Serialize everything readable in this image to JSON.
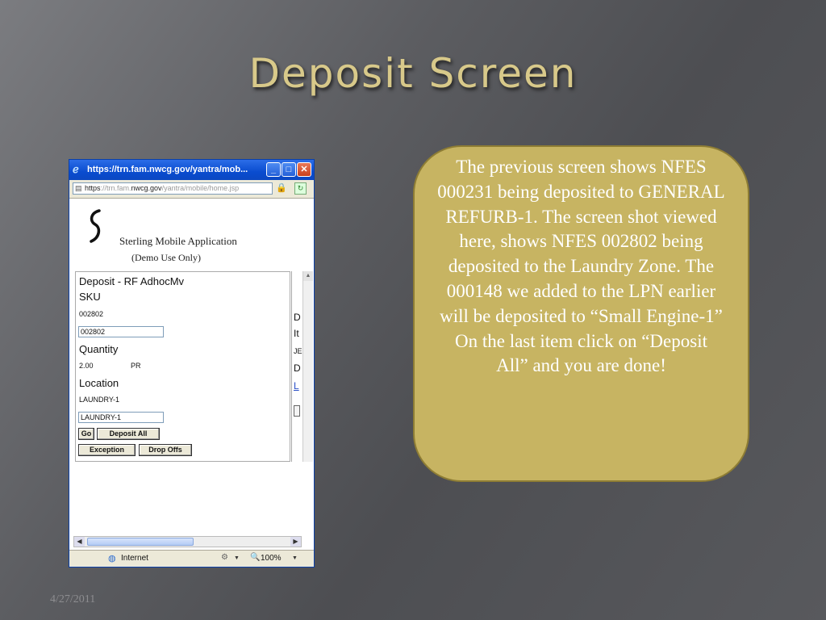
{
  "slide": {
    "title": "Deposit Screen",
    "callout_text": "The previous screen shows NFES 000231 being deposited to GENERAL REFURB-1. The screen shot viewed here, shows NFES 002802 being deposited to the Laundry Zone. The 000148 we added to the LPN earlier will be deposited to “Small Engine-1” On the last item click on “Deposit All”  and you are done!",
    "date": "4/27/2011",
    "callout_color": "#c7b462"
  },
  "browser": {
    "title": "https://trn.fam.nwcg.gov/yantra/mob...",
    "address_scheme": "https",
    "address_mid1": "://trn.fam.",
    "address_domain": "nwcg.gov",
    "address_path": "/yantra/mobile/home.jsp",
    "status_zone": "Internet",
    "zoom": "100%",
    "titlebar_color": "#0a4ccf"
  },
  "app": {
    "name": "Sterling Mobile Application",
    "subtitle": "(Demo Use Only)"
  },
  "form": {
    "header": "Deposit -  RF AdhocMv",
    "sku_label": "SKU",
    "sku_value": "002802",
    "sku_input": "002802",
    "quantity_label": "Quantity",
    "quantity_value": "2.00",
    "quantity_uom": "PR",
    "location_label": "Location",
    "location_value": "LAUNDRY-1",
    "location_input": "LAUNDRY-1",
    "go_button": "Go",
    "deposit_all_button": "Deposit All",
    "exception_button": "Exception",
    "drop_offs_button": "Drop Offs"
  },
  "side_fragments": [
    "D",
    "It",
    "JE",
    "D",
    "L"
  ]
}
